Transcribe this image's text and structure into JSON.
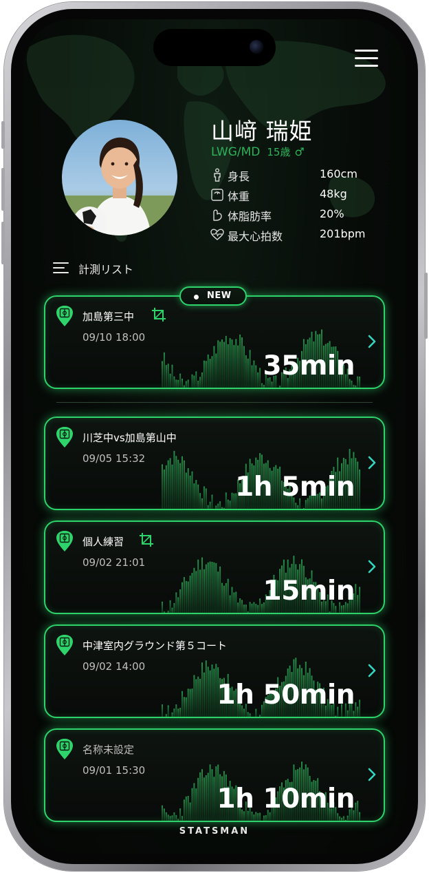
{
  "profile": {
    "name": "山﨑 瑞姫",
    "position": "LWG/MD",
    "age": "15歳",
    "gender_symbol": "♂",
    "stats": [
      {
        "icon": "body-icon",
        "label": "身長",
        "value": "160cm"
      },
      {
        "icon": "scale-icon",
        "label": "体重",
        "value": "48kg"
      },
      {
        "icon": "arm-icon",
        "label": "体脂肪率",
        "value": "20%"
      },
      {
        "icon": "heart-rate-icon",
        "label": "最大心拍数",
        "value": "201bpm"
      }
    ]
  },
  "list": {
    "title": "計測リスト",
    "new_badge": "NEW",
    "items": [
      {
        "title": "加島第三中",
        "datetime": "09/10 18:00",
        "duration": "35min",
        "has_crop": true,
        "muted": false
      },
      {
        "title": "川芝中vs加島第山中",
        "datetime": "09/05 15:32",
        "duration": "1h 5min",
        "has_crop": false,
        "muted": false
      },
      {
        "title": "個人練習",
        "datetime": "09/02 21:01",
        "duration": "15min",
        "has_crop": true,
        "muted": false
      },
      {
        "title": "中津室内グラウンド第５コート",
        "datetime": "09/02 14:00",
        "duration": "1h 50min",
        "has_crop": false,
        "muted": false
      },
      {
        "title": "名称未設定",
        "datetime": "09/01 15:30",
        "duration": "1h 10min",
        "has_crop": false,
        "muted": true
      }
    ]
  },
  "brand": "STATSMAN",
  "colors": {
    "accent": "#2fd36b",
    "accent_text": "#2fb35a",
    "background": "#070b08"
  }
}
